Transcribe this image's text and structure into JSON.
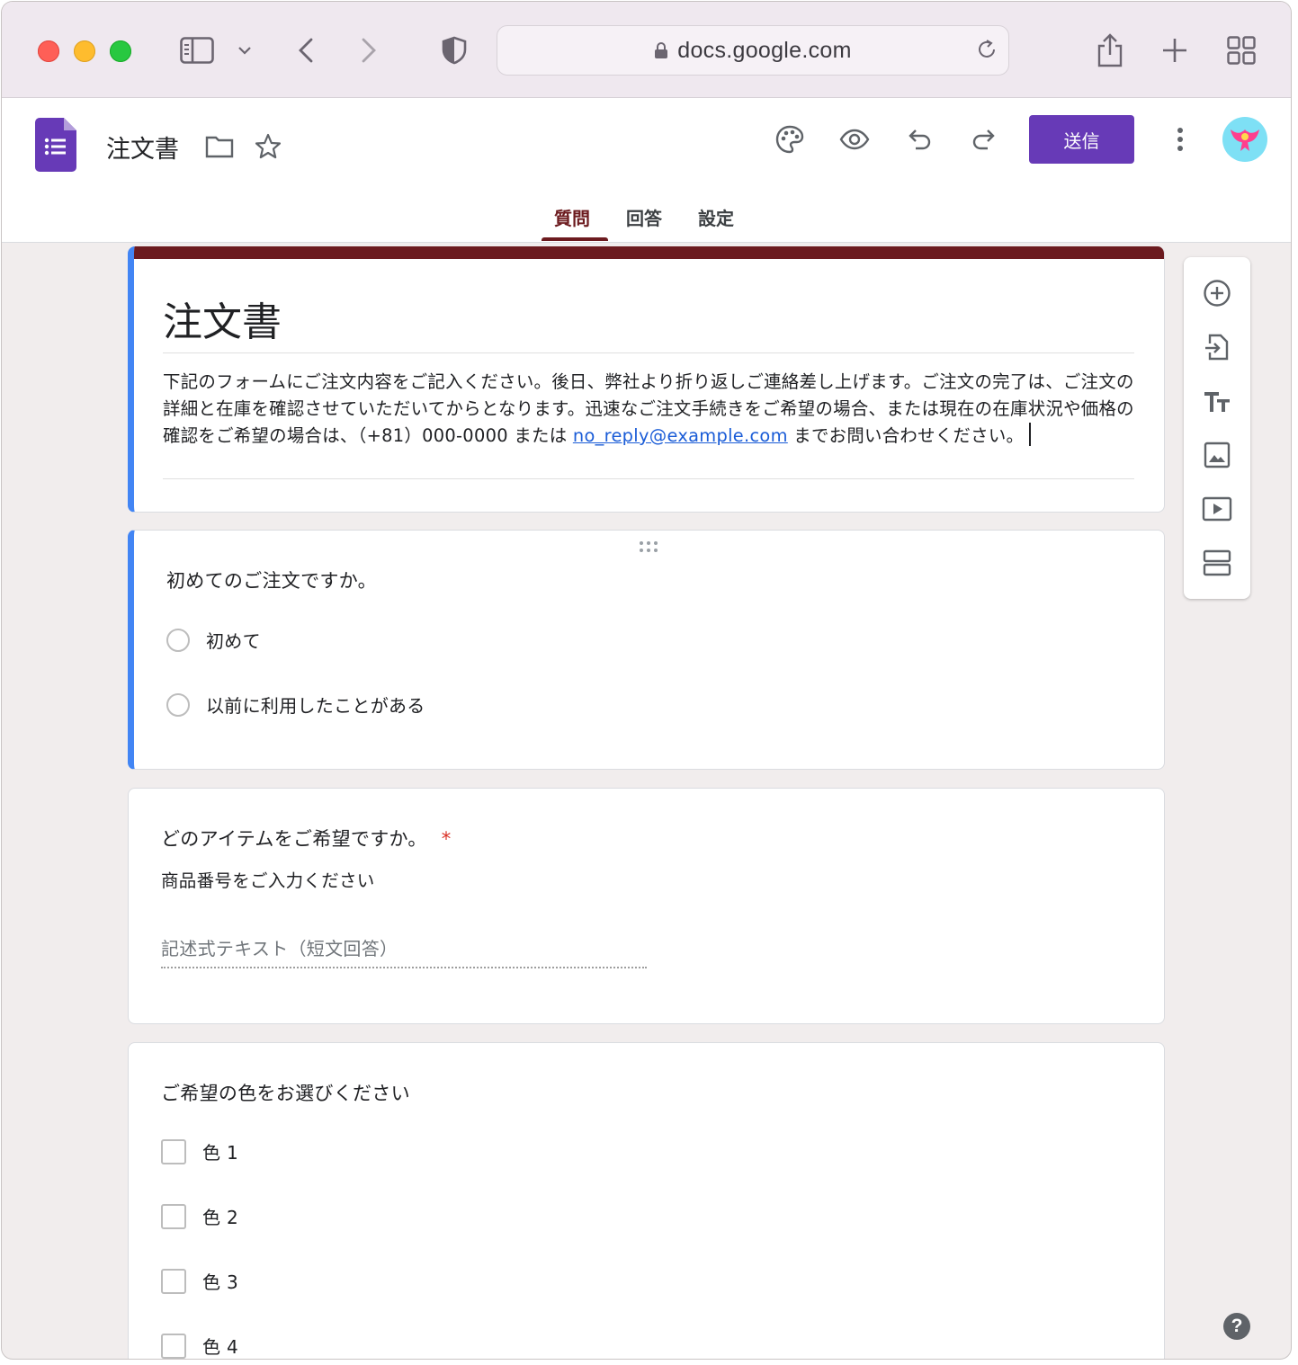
{
  "browser": {
    "url": "docs.google.com"
  },
  "header": {
    "doc_title": "注文書",
    "send_label": "送信",
    "tabs": [
      {
        "label": "質問",
        "active": true
      },
      {
        "label": "回答",
        "active": false
      },
      {
        "label": "設定",
        "active": false
      }
    ],
    "theme_color": "#6c1b1f",
    "accent_color": "#673ab7"
  },
  "form": {
    "title": "注文書",
    "description_before_link": "下記のフォームにご注文内容をご記入ください。後日、弊社より折り返しご連絡差し上げます。ご注文の完了は、ご注文の詳細と在庫を確認させていただいてからとなります。迅速なご注文手続きをご希望の場合、または現在の在庫状況や価格の確認をご希望の場合は、（+81）000-0000 または ",
    "description_link": "no_reply@example.com",
    "description_after_link": " までお問い合わせください。"
  },
  "questions": [
    {
      "title": "初めてのご注文ですか。",
      "type": "radio",
      "options": [
        "初めて",
        "以前に利用したことがある"
      ]
    },
    {
      "title": "どのアイテムをご希望ですか。",
      "required_mark": "*",
      "description": "商品番号をご入力ください",
      "type": "short_text",
      "placeholder": "記述式テキスト（短文回答）"
    },
    {
      "title": "ご希望の色をお選びください",
      "type": "checkbox",
      "options": [
        "色 1",
        "色 2",
        "色 3",
        "色 4"
      ]
    }
  ],
  "side_toolbar": [
    "add-question-icon",
    "import-questions-icon",
    "add-title-icon",
    "add-image-icon",
    "add-video-icon",
    "add-section-icon"
  ],
  "help_label": "?"
}
